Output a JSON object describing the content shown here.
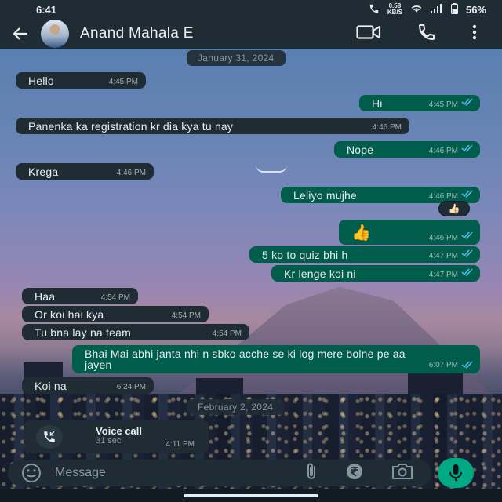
{
  "status_bar": {
    "time": "6:41",
    "net_speed": "0.58",
    "net_unit": "KB/S",
    "battery": "56%"
  },
  "header": {
    "contact_name": "Anand Mahala E",
    "icons": [
      "back-arrow-icon",
      "video-call-icon",
      "phone-icon",
      "more-vert-icon"
    ]
  },
  "dates": [
    "January 31, 2024",
    "February 2, 2024"
  ],
  "messages": [
    {
      "dir": "in",
      "text": "Hello",
      "time": "4:45 PM"
    },
    {
      "dir": "out",
      "text": "Hi",
      "time": "4:45 PM"
    },
    {
      "dir": "in",
      "text": "Panenka ka registration kr dia kya tu nay",
      "time": "4:46 PM"
    },
    {
      "dir": "out",
      "text": "Nope",
      "time": "4:46 PM"
    },
    {
      "dir": "in",
      "text": "Krega",
      "time": "4:46 PM"
    },
    {
      "dir": "out",
      "text": "Leliyo mujhe",
      "time": "4:46 PM",
      "reaction": "👍🏻"
    },
    {
      "dir": "out",
      "text": "👍",
      "time": "4:46 PM"
    },
    {
      "dir": "out",
      "text": "5 ko to quiz bhi h",
      "time": "4:47 PM"
    },
    {
      "dir": "out",
      "text": "Kr lenge koi ni",
      "time": "4:47 PM"
    },
    {
      "dir": "in",
      "text": "Haa",
      "time": "4:54 PM"
    },
    {
      "dir": "in",
      "text": "Or koi hai kya",
      "time": "4:54 PM"
    },
    {
      "dir": "in",
      "text": "Tu bna lay na team",
      "time": "4:54 PM"
    },
    {
      "dir": "out",
      "text": "Bhai Mai abhi janta nhi n sbko acche se ki log mere bolne pe aa jayen",
      "time": "6:07 PM"
    },
    {
      "dir": "in",
      "text": "Koi na",
      "time": "6:24 PM"
    }
  ],
  "voice_call": {
    "title": "Voice call",
    "duration": "31 sec",
    "time": "4:11 PM"
  },
  "composer": {
    "placeholder": "Message",
    "icons": [
      "emoji-icon",
      "attach-icon",
      "rupee-icon",
      "camera-icon",
      "mic-icon"
    ]
  },
  "colors": {
    "incoming_bubble": "#202c33",
    "outgoing_bubble": "#005c4b",
    "accent": "#00a884",
    "read_ticks": "#53bdeb"
  }
}
